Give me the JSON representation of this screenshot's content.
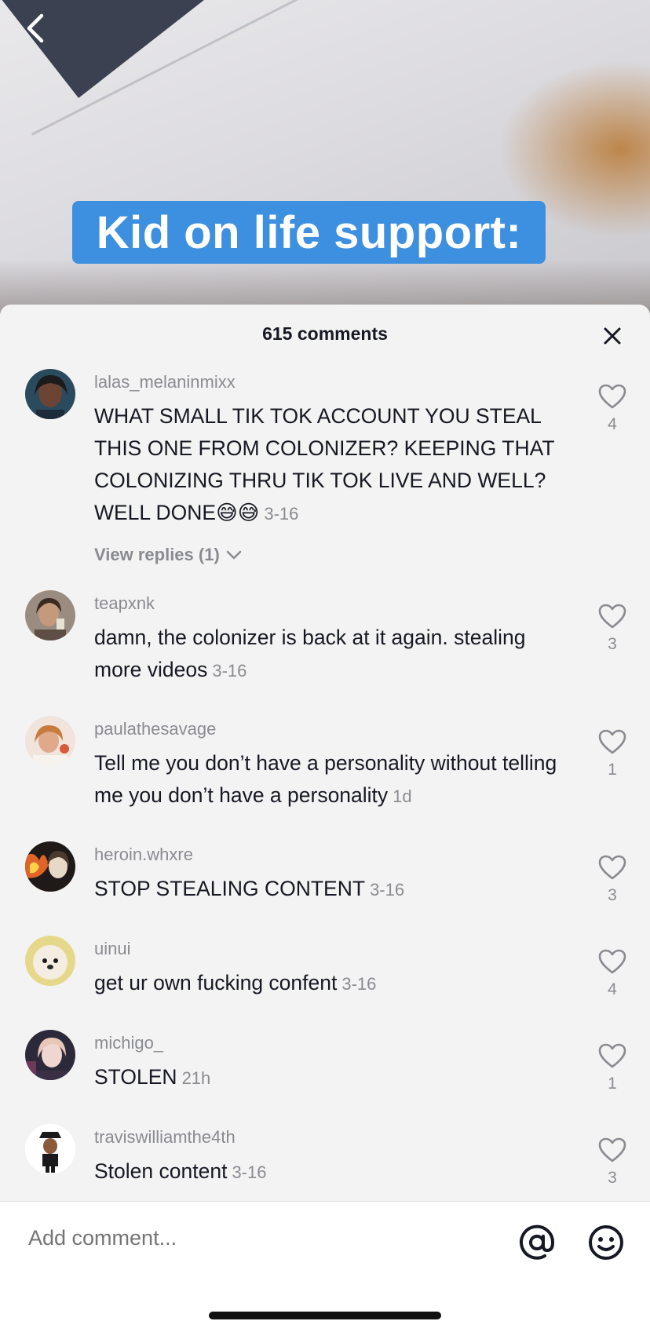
{
  "video": {
    "caption": "Kid on life support:"
  },
  "sheet": {
    "title": "615 comments"
  },
  "comments": [
    {
      "username": "lalas_melaninmixx",
      "text": "WHAT SMALL TIK TOK ACCOUNT YOU STEAL THIS ONE FROM COLONIZER? KEEPING THAT COLONIZING THRU TIK TOK LIVE AND WELL? WELL DONE😅😅",
      "date": "3-16",
      "likes": "4",
      "view_replies": "View replies (1)",
      "avatar_color": "#2a4a5e"
    },
    {
      "username": "teapxnk",
      "text": "damn, the colonizer is back at it again. stealing more videos",
      "date": "3-16",
      "likes": "3",
      "avatar_color": "#9a8c80"
    },
    {
      "username": "paulathesavage",
      "text": "Tell me you don’t have a personality without telling me you don’t have a personality",
      "date": "1d",
      "likes": "1",
      "avatar_color": "#e0a98a"
    },
    {
      "username": "heroin.whxre",
      "text": "STOP STEALING CONTENT",
      "date": "3-16",
      "likes": "3",
      "avatar_color": "#c4552b"
    },
    {
      "username": "uinui",
      "text": "get ur own fucking confent",
      "date": "3-16",
      "likes": "4",
      "avatar_color": "#e9e2cf"
    },
    {
      "username": "michigo_",
      "text": "STOLEN",
      "date": "21h",
      "likes": "1",
      "avatar_color": "#6b3a5a"
    },
    {
      "username": "traviswilliamthe4th",
      "text": "Stolen content",
      "date": "3-16",
      "likes": "3",
      "avatar_color": "#ffffff"
    }
  ],
  "input": {
    "placeholder": "Add comment..."
  },
  "colors": {
    "caption_bg": "#3d8fdf",
    "text_primary": "#161823",
    "text_secondary": "#8a8b91"
  }
}
